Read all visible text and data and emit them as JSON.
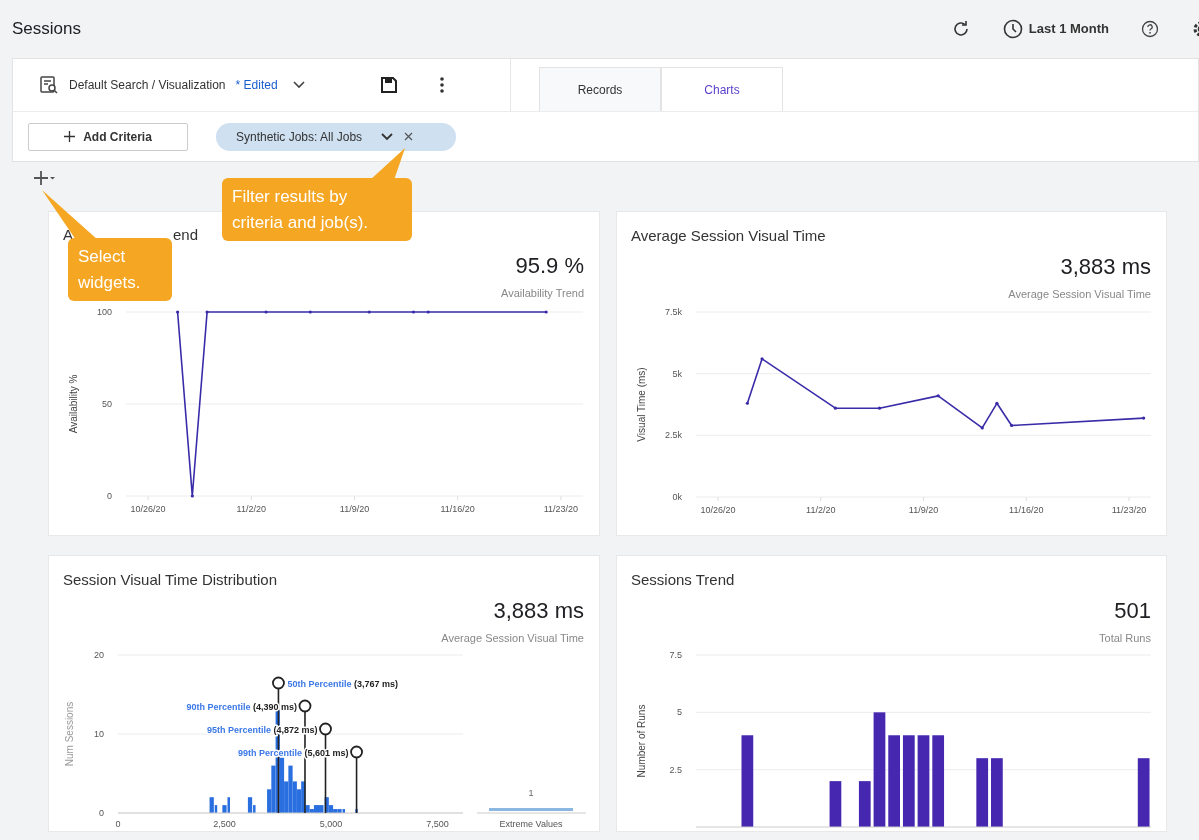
{
  "page": {
    "title": "Sessions",
    "time_range": "Last 1 Month"
  },
  "search": {
    "name": "Default Search / Visualization",
    "edited_label": "* Edited"
  },
  "tabs": [
    {
      "label": "Records",
      "selected": false
    },
    {
      "label": "Charts",
      "selected": true
    }
  ],
  "criteria": {
    "add_button": "Add Criteria",
    "chips": [
      {
        "label": "Synthetic Jobs: All Jobs"
      }
    ]
  },
  "tooltips": [
    {
      "kind": "widgets",
      "text": "Select widgets."
    },
    {
      "kind": "filter",
      "text": "Filter results by criteria and job(s)."
    }
  ],
  "cards": [
    {
      "title_parts": [
        "A",
        "end"
      ],
      "value": "95.9 %",
      "value_label": "Availability Trend",
      "chart_data": {
        "type": "line",
        "ylabel": "Availability %",
        "categories": [
          null,
          "10/26/20",
          null,
          null,
          null,
          null,
          null,
          null,
          "11/2/20",
          null,
          null,
          null,
          null,
          null,
          null,
          "11/9/20",
          null,
          null,
          null,
          null,
          null,
          null,
          "11/16/20",
          null,
          null,
          null,
          null,
          null,
          null,
          "11/23/20",
          null
        ],
        "series": [
          {
            "color": "#3a2ca8",
            "values": [
              null,
              null,
              null,
              100,
              0,
              100,
              null,
              null,
              null,
              100,
              null,
              null,
              100,
              null,
              null,
              null,
              100,
              null,
              null,
              100,
              100,
              null,
              null,
              null,
              null,
              null,
              null,
              null,
              100,
              null,
              null
            ]
          }
        ],
        "ylim": [
          0,
          100
        ],
        "yticks": [
          0,
          50,
          100
        ]
      }
    },
    {
      "title": "Average Session Visual Time",
      "value": "3,883 ms",
      "value_label": "Average Session Visual Time",
      "chart_data": {
        "type": "line",
        "ylabel": "Visual Time (ms)",
        "categories": [
          null,
          "10/26/20",
          null,
          null,
          null,
          null,
          null,
          null,
          "11/2/20",
          null,
          null,
          null,
          null,
          null,
          null,
          "11/9/20",
          null,
          null,
          null,
          null,
          null,
          null,
          "11/16/20",
          null,
          null,
          null,
          null,
          null,
          null,
          "11/23/20",
          null
        ],
        "series": [
          {
            "color": "#3a2ca8",
            "values": [
              null,
              null,
              null,
              3800,
              5600,
              null,
              null,
              null,
              null,
              3600,
              null,
              null,
              3600,
              null,
              null,
              null,
              4100,
              null,
              null,
              2800,
              3800,
              2900,
              null,
              null,
              null,
              null,
              null,
              null,
              null,
              null,
              3200
            ]
          }
        ],
        "ylim": [
          0,
          7500
        ],
        "yticks": [
          {
            "value": 0,
            "label": "0k"
          },
          {
            "value": 2500,
            "label": "2.5k"
          },
          {
            "value": 5000,
            "label": "5k"
          },
          {
            "value": 7500,
            "label": "7.5k"
          }
        ]
      }
    },
    {
      "title": "Session Visual Time Distribution",
      "value": "3,883 ms",
      "value_label": "Average Session Visual Time",
      "extreme_values": {
        "count": "1",
        "label": "Extreme Values"
      },
      "chart_data": {
        "type": "bar",
        "ylabel": "Num Sessions",
        "x": [
          2200,
          2300,
          2500,
          2600,
          3100,
          3200,
          3550,
          3650,
          3750,
          3850,
          3950,
          4050,
          4150,
          4250,
          4350,
          4450,
          4550,
          4650,
          4750,
          4900,
          5000,
          5100,
          5200,
          5300,
          5600
        ],
        "series": [
          {
            "color": "#2a6fe0",
            "values": [
              2,
              1,
              1,
              2,
              2,
              1,
              3,
              6,
              13,
              7,
              4,
              6,
              4,
              3,
              4,
              1,
              0.5,
              1,
              1,
              2,
              1,
              0.5,
              0.5,
              0.5,
              0.5
            ]
          }
        ],
        "xlim": [
          0,
          8100
        ],
        "ylim": [
          0,
          20
        ],
        "xticks": [
          {
            "value": 0,
            "label": "0"
          },
          {
            "value": 2500,
            "label": "2,500"
          },
          {
            "value": 5000,
            "label": "5,000"
          },
          {
            "value": 7500,
            "label": "7,500"
          }
        ],
        "yticks": [
          0,
          10,
          20
        ],
        "annotations": [
          {
            "x": 3767,
            "text": "50th Percentile (3,767 ms)"
          },
          {
            "x": 4390,
            "text": "90th Percentile (4,390 ms)"
          },
          {
            "x": 4872,
            "text": "95th Percentile (4,872 ms)"
          },
          {
            "x": 5601,
            "text": "99th Percentile (5,601 ms)"
          }
        ]
      }
    },
    {
      "title": "Sessions Trend",
      "value": "501",
      "value_label": "Total Runs",
      "chart_data": {
        "type": "bar",
        "ylabel": "Number of Runs",
        "categories": [
          null,
          null,
          null,
          null,
          null,
          null,
          null,
          null,
          null,
          null,
          null,
          null,
          null,
          null,
          null,
          null,
          null,
          null,
          null,
          null,
          null,
          null,
          null,
          null,
          null,
          null,
          null,
          null,
          null,
          null,
          null
        ],
        "series": [
          {
            "color": "#4527b0",
            "values": [
              null,
              null,
              null,
              4,
              null,
              null,
              null,
              null,
              null,
              2,
              null,
              2,
              5,
              4,
              4,
              4,
              4,
              null,
              null,
              3,
              3,
              null,
              null,
              null,
              null,
              null,
              null,
              null,
              null,
              null,
              3
            ]
          }
        ],
        "ylim": [
          0,
          7.5
        ],
        "yticks": [
          2.5,
          5,
          7.5
        ]
      }
    }
  ]
}
